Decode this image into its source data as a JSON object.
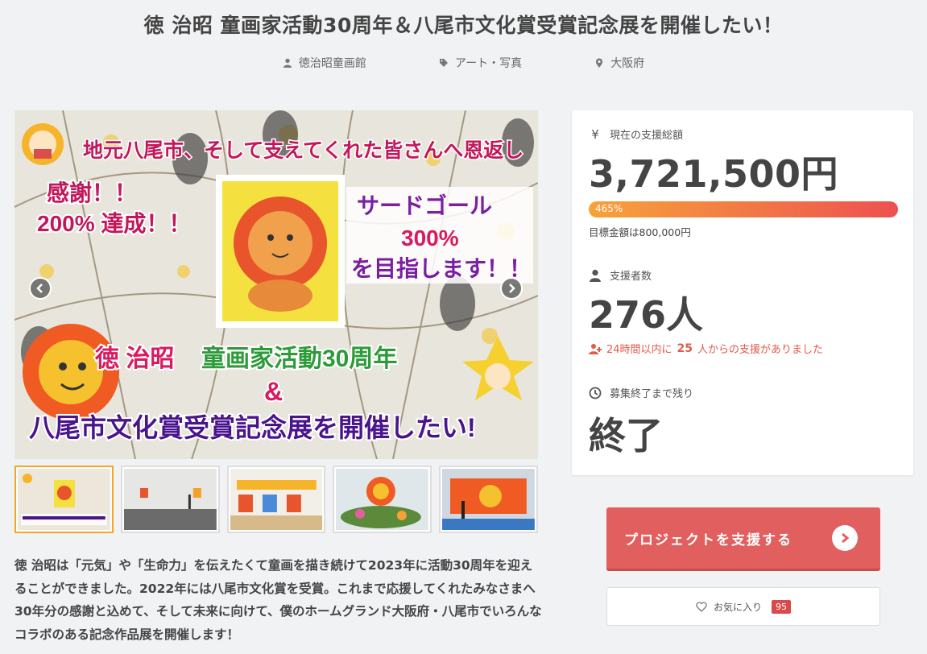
{
  "page": {
    "title": "徳 治昭 童画家活動30周年＆八尾市文化賞受賞記念展を開催したい！"
  },
  "meta": {
    "owner": "徳治昭童画館",
    "category": "アート・写真",
    "location": "大阪府"
  },
  "hero": {
    "banner_top": "地元八尾市、そして支えてくれた皆さんへ恩返し",
    "thanks_line1": "感謝！！",
    "thanks_line2": "200% 達成！！",
    "goal_line1": "サードゴール",
    "goal_line2": "300%",
    "goal_line3": "を目指します！！",
    "headline1_a": "徳 治昭",
    "headline1_b": "童画家活動30周年",
    "headline_amp": "&",
    "headline2": "八尾市文化賞受賞記念展を開催したい!"
  },
  "description": "徳 治昭は「元気」や「生命力」を伝えたくて童画を描き続けて2023年に活動30周年を迎えることができました。2022年には八尾市文化賞を受賞。これまで応援してくれたみなさまへ30年分の感謝と込めて、そして未来に向けて、僕のホームグランド大阪府・八尾市でいろんなコラボのある記念作品展を開催します！",
  "stats": {
    "total_label": "現在の支援総額",
    "total_amount": "3,721,500円",
    "progress_percent": 465,
    "progress_label": "465%",
    "goal_text": "目標金額は800,000円",
    "supporters_label": "支援者数",
    "supporters_count": "276人",
    "recent_prefix": "24時間以内に",
    "recent_number": "25",
    "recent_suffix": "人からの支援がありました",
    "remaining_label": "募集終了まで残り",
    "remaining_value": "終了"
  },
  "actions": {
    "support_label": "プロジェクトを支援する",
    "favorite_label": "お気に入り",
    "favorite_count": "95"
  },
  "colors": {
    "accent": "#e25f5f",
    "progress_start": "#f7a23a",
    "progress_end": "#ee5050",
    "thumb_active": "#f5a623"
  }
}
